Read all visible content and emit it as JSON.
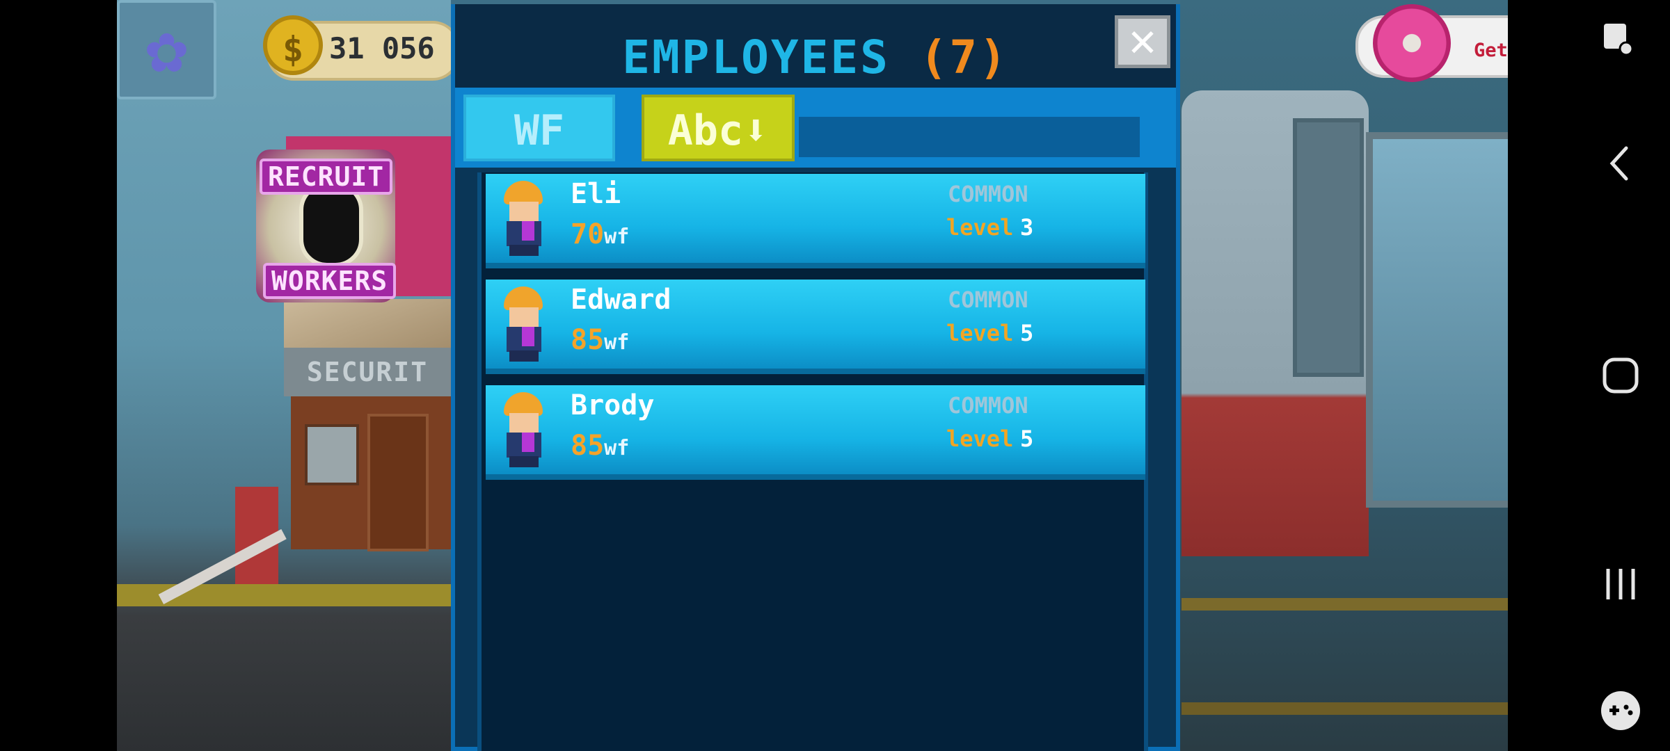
{
  "hud": {
    "coins": "31 056",
    "coin_symbol": "$",
    "recruit_line1": "RECRUIT",
    "recruit_line2": "WORKERS",
    "security_sign": "SECURIT",
    "get_more": "Get more"
  },
  "dialog": {
    "title": "EMPLOYEES",
    "count": "(7)",
    "close_glyph": "✕",
    "tabs": [
      {
        "label": "WF",
        "active": false
      },
      {
        "label": "Abc⬇",
        "active": true
      }
    ],
    "employees": [
      {
        "name": "Eli",
        "wf_value": "70",
        "wf_unit": "wf",
        "rarity": "COMMON",
        "level_word": "level",
        "level": "3"
      },
      {
        "name": "Edward",
        "wf_value": "85",
        "wf_unit": "wf",
        "rarity": "COMMON",
        "level_word": "level",
        "level": "5"
      },
      {
        "name": "Brody",
        "wf_value": "85",
        "wf_unit": "wf",
        "rarity": "COMMON",
        "level_word": "level",
        "level": "5"
      }
    ]
  },
  "system_nav": {
    "icons": [
      "screen-touch-icon",
      "back-icon",
      "home-icon",
      "recents-icon",
      "game-tools-icon"
    ]
  },
  "colors": {
    "title": "#1fb6e6",
    "count": "#f08a1e",
    "card": "#16b4e6",
    "wf_value": "#f5a329",
    "tab_sort": "#c6d21a"
  }
}
